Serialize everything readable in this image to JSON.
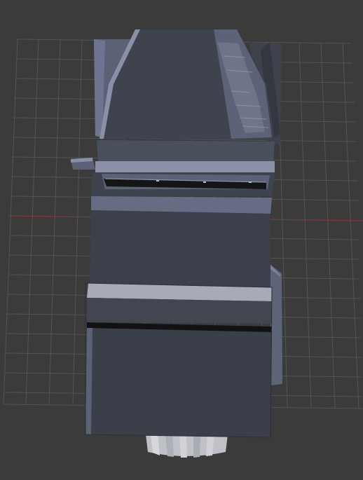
{
  "viewport": {
    "background": "#3b3b3b",
    "grid_color": "#575757",
    "axis_x_color": "#7f3a3a"
  },
  "object": {
    "description_visible": "",
    "palette": {
      "edge_light": "#8a90a8",
      "face_mid": "#5b6276",
      "face_dark": "#3e424d",
      "face_deep": "#343740",
      "slot": "#151515",
      "stripe_light": "#a7abb9",
      "base_metal": "#c6c7cc"
    }
  }
}
